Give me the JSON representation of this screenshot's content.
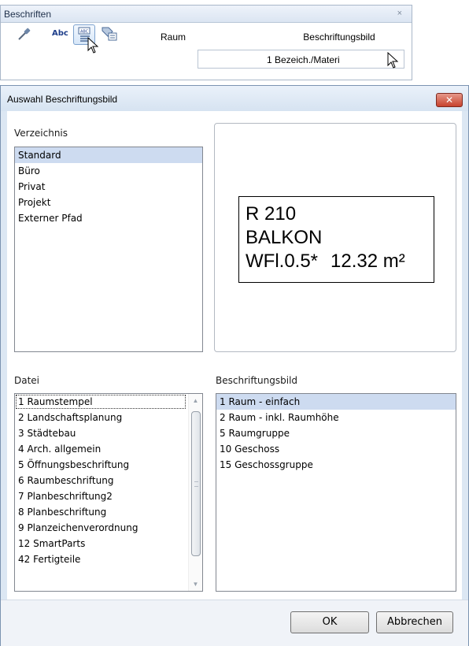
{
  "palette": {
    "title": "Beschriften",
    "close_glyph": "×",
    "abc_label": "Abc",
    "raum_label": "Raum",
    "beschriftungsbild_label": "Beschriftungsbild",
    "beschriftungsbild_value": "1 Bezeich./Materi"
  },
  "dialog": {
    "title": "Auswahl Beschriftungsbild",
    "close_glyph": "✕",
    "verzeichnis_label": "Verzeichnis",
    "verzeichnis_items": [
      "Standard",
      "Büro",
      "Privat",
      "Projekt",
      "Externer Pfad"
    ],
    "verzeichnis_selected": 0,
    "preview": {
      "line1": "R 210",
      "line2": "BALKON",
      "line3a": "WFl.0.5*",
      "line3b": "12.32 m²"
    },
    "datei_label": "Datei",
    "datei_items": [
      "1 Raumstempel",
      "2 Landschaftsplanung",
      "3 Städtebau",
      "4 Arch. allgemein",
      "5 Öffnungsbeschriftung",
      "6 Raumbeschriftung",
      "7 Planbeschriftung2",
      "8 Planbeschriftung",
      "9 Planzeichenverordnung",
      "12 SmartParts",
      "42 Fertigteile"
    ],
    "datei_focused": 0,
    "bild_label": "Beschriftungsbild",
    "bild_items": [
      "1 Raum - einfach",
      "2 Raum - inkl. Raumhöhe",
      "5 Raumgruppe",
      "10 Geschoss",
      "15 Geschossgruppe"
    ],
    "bild_selected": 0,
    "ok_label": "OK",
    "cancel_label": "Abbrechen"
  },
  "colors": {
    "selection": "#cddbf0",
    "dialog_frame": "#dce7f3",
    "close_red": "#c7422d"
  }
}
